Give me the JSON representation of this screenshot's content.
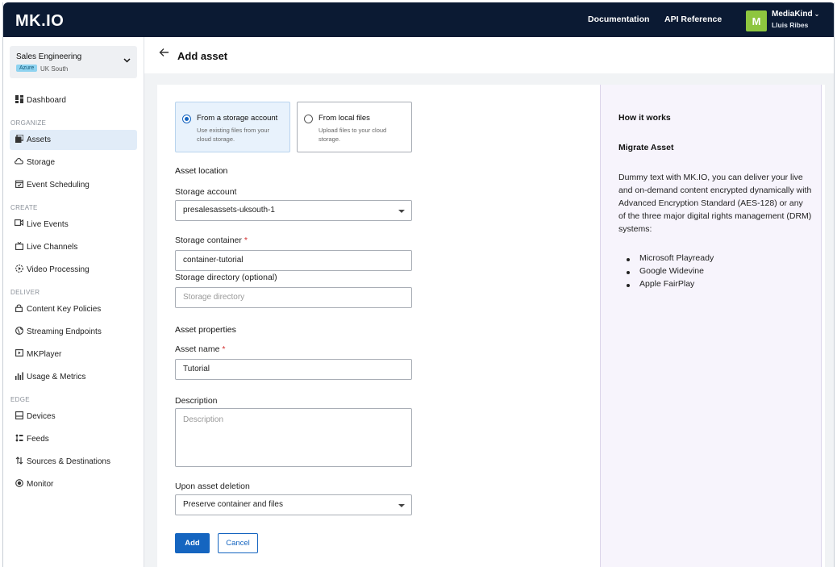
{
  "app": {
    "logo": "MK.IO"
  },
  "topbar": {
    "documentation": "Documentation",
    "api_reference": "API Reference",
    "avatar_letter": "M",
    "org": "MediaKind",
    "user": "Lluis Ribes"
  },
  "sidebar": {
    "org_name": "Sales Engineering",
    "org_badge": "Azure",
    "org_region": "UK South",
    "dashboard": "Dashboard",
    "sections": {
      "organize": "ORGANIZE",
      "create": "CREATE",
      "deliver": "DELIVER",
      "edge": "EDGE"
    },
    "items": {
      "assets": "Assets",
      "storage": "Storage",
      "event_scheduling": "Event Scheduling",
      "live_events": "Live Events",
      "live_channels": "Live Channels",
      "video_processing": "Video Processing",
      "content_key_policies": "Content Key Policies",
      "streaming_endpoints": "Streaming Endpoints",
      "mkplayer": "MKPlayer",
      "usage_metrics": "Usage & Metrics",
      "devices": "Devices",
      "feeds": "Feeds",
      "sources_destinations": "Sources & Destinations",
      "monitor": "Monitor"
    },
    "active": "assets"
  },
  "page": {
    "title": "Add asset"
  },
  "form": {
    "source_storage": {
      "title": "From a storage account",
      "desc": "Use existing files from your cloud storage.",
      "selected": true
    },
    "source_local": {
      "title": "From local files",
      "desc": "Upload files to your cloud storage.",
      "selected": false
    },
    "asset_location": "Asset location",
    "storage_account_label": "Storage account",
    "storage_account_value": "presalesassets-uksouth-1",
    "storage_container_label": "Storage container",
    "storage_container_value": "container-tutorial",
    "storage_directory_label": "Storage directory (optional)",
    "storage_directory_placeholder": "Storage directory",
    "asset_properties": "Asset properties",
    "asset_name_label": "Asset name",
    "asset_name_value": "Tutorial",
    "description_label": "Description",
    "description_placeholder": "Description",
    "deletion_label": "Upon asset deletion",
    "deletion_value": "Preserve container and files",
    "required_mark": "*",
    "add_button": "Add",
    "cancel_button": "Cancel"
  },
  "info": {
    "how_it_works": "How it works",
    "migrate_asset": "Migrate Asset",
    "body": "Dummy text with MK.IO, you can deliver your live and on-demand content encrypted dynamically with Advanced Encryption Standard (AES-128) or any of the three major digital rights management (DRM) systems:",
    "list": [
      "Microsoft Playready",
      "Google Widevine",
      "Apple FairPlay"
    ]
  },
  "colors": {
    "topbar": "#0b1a33",
    "accent": "#1565c0",
    "avatar": "#8ec63f",
    "info_bg": "#f7f4fc"
  }
}
